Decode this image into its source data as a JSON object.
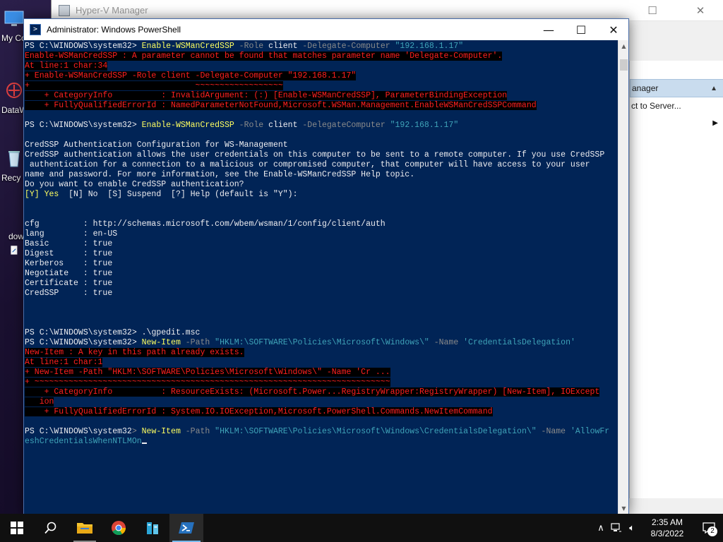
{
  "desktop": {
    "icons": [
      {
        "label": "My Co",
        "icon": "computer-icon"
      },
      {
        "label": "DataW",
        "icon": "app-icon"
      },
      {
        "label": "Recy",
        "icon": "recycle-bin-icon"
      },
      {
        "label": "dow",
        "icon": "file-icon"
      }
    ]
  },
  "hyperv": {
    "title": "Hyper-V Manager",
    "actions_header": "anager",
    "actions": [
      {
        "label": "ct to Server...",
        "has_arrow": false
      },
      {
        "label": "",
        "has_arrow": true
      }
    ]
  },
  "powershell": {
    "title": "Administrator: Windows PowerShell",
    "lines": [
      [
        {
          "t": "PS C:\\WINDOWS\\system32> ",
          "c": "default"
        },
        {
          "t": "Enable-WSManCredSSP",
          "c": "cmd"
        },
        {
          "t": " -Role ",
          "c": "param"
        },
        {
          "t": "client",
          "c": "default"
        },
        {
          "t": " -Delegate-Computer ",
          "c": "param"
        },
        {
          "t": "\"192.168.1.17\"",
          "c": "string"
        }
      ],
      [
        {
          "t": "Enable-WSManCredSSP : A parameter cannot be found that matches parameter name 'Delegate-Computer'.",
          "c": "err"
        }
      ],
      [
        {
          "t": "At line:1 char:34",
          "c": "err"
        }
      ],
      [
        {
          "t": "+ Enable-WSManCredSSP -Role client -Delegate-Computer \"192.168.1.17\"",
          "c": "err"
        }
      ],
      [
        {
          "t": "+                                  ~~~~~~~~~~~~~~~~~~",
          "c": "err"
        }
      ],
      [
        {
          "t": "    + CategoryInfo          : InvalidArgument: (:) [Enable-WSManCredSSP], ParameterBindingException",
          "c": "err"
        }
      ],
      [
        {
          "t": "    + FullyQualifiedErrorId : NamedParameterNotFound,Microsoft.WSMan.Management.EnableWSManCredSSPCommand",
          "c": "err"
        }
      ],
      [
        {
          "t": "",
          "c": "default"
        }
      ],
      [
        {
          "t": "PS C:\\WINDOWS\\system32> ",
          "c": "default"
        },
        {
          "t": "Enable-WSManCredSSP",
          "c": "cmd"
        },
        {
          "t": " -Role ",
          "c": "param"
        },
        {
          "t": "client",
          "c": "default"
        },
        {
          "t": " -DelegateComputer ",
          "c": "param"
        },
        {
          "t": "\"192.168.1.17\"",
          "c": "string"
        }
      ],
      [
        {
          "t": "",
          "c": "default"
        }
      ],
      [
        {
          "t": "CredSSP Authentication Configuration for WS-Management",
          "c": "default"
        }
      ],
      [
        {
          "t": "CredSSP authentication allows the user credentials on this computer to be sent to a remote computer. If you use CredSSP",
          "c": "default"
        }
      ],
      [
        {
          "t": " authentication for a connection to a malicious or compromised computer, that computer will have access to your user",
          "c": "default"
        }
      ],
      [
        {
          "t": "name and password. For more information, see the Enable-WSManCredSSP Help topic.",
          "c": "default"
        }
      ],
      [
        {
          "t": "Do you want to enable CredSSP authentication?",
          "c": "default"
        }
      ],
      [
        {
          "t": "[Y] Yes",
          "c": "prompty"
        },
        {
          "t": "  [N] No  [S] Suspend  [?] Help (default is \"Y\"):",
          "c": "default"
        }
      ],
      [
        {
          "t": "",
          "c": "default"
        }
      ],
      [
        {
          "t": "",
          "c": "default"
        }
      ],
      [
        {
          "t": "cfg         : http://schemas.microsoft.com/wbem/wsman/1/config/client/auth",
          "c": "default"
        }
      ],
      [
        {
          "t": "lang        : en-US",
          "c": "default"
        }
      ],
      [
        {
          "t": "Basic       : true",
          "c": "default"
        }
      ],
      [
        {
          "t": "Digest      : true",
          "c": "default"
        }
      ],
      [
        {
          "t": "Kerberos    : true",
          "c": "default"
        }
      ],
      [
        {
          "t": "Negotiate   : true",
          "c": "default"
        }
      ],
      [
        {
          "t": "Certificate : true",
          "c": "default"
        }
      ],
      [
        {
          "t": "CredSSP     : true",
          "c": "default"
        }
      ],
      [
        {
          "t": "",
          "c": "default"
        }
      ],
      [
        {
          "t": "",
          "c": "default"
        }
      ],
      [
        {
          "t": "",
          "c": "default"
        }
      ],
      [
        {
          "t": "PS C:\\WINDOWS\\system32> ",
          "c": "default"
        },
        {
          "t": ".\\gpedit.msc",
          "c": "default"
        }
      ],
      [
        {
          "t": "PS C:\\WINDOWS\\system32> ",
          "c": "default"
        },
        {
          "t": "New-Item",
          "c": "cmd"
        },
        {
          "t": " -Path ",
          "c": "param"
        },
        {
          "t": "\"HKLM:\\SOFTWARE\\Policies\\Microsoft\\Windows\\\"",
          "c": "string"
        },
        {
          "t": " -Name ",
          "c": "param"
        },
        {
          "t": "'CredentialsDelegation'",
          "c": "string"
        }
      ],
      [
        {
          "t": "New-Item : A key in this path already exists.",
          "c": "err"
        }
      ],
      [
        {
          "t": "At line:1 char:1",
          "c": "err"
        }
      ],
      [
        {
          "t": "+ New-Item -Path \"HKLM:\\SOFTWARE\\Policies\\Microsoft\\Windows\\\" -Name 'Cr ...",
          "c": "err"
        }
      ],
      [
        {
          "t": "+ ~~~~~~~~~~~~~~~~~~~~~~~~~~~~~~~~~~~~~~~~~~~~~~~~~~~~~~~~~~~~~~~~~~~~~~~~~",
          "c": "err"
        }
      ],
      [
        {
          "t": "    + CategoryInfo          : ResourceExists: (Microsoft.Power...RegistryWrapper:RegistryWrapper) [New-Item], IOExcept",
          "c": "err"
        }
      ],
      [
        {
          "t": "   ion",
          "c": "err"
        }
      ],
      [
        {
          "t": "    + FullyQualifiedErrorId : System.IO.IOException,Microsoft.PowerShell.Commands.NewItemCommand",
          "c": "err"
        }
      ],
      [
        {
          "t": "",
          "c": "default"
        }
      ],
      [
        {
          "t": "PS C:\\WINDOWS\\system32",
          "c": "default"
        },
        {
          "t": "> ",
          "c": "gray"
        },
        {
          "t": "New-Item",
          "c": "cmd"
        },
        {
          "t": " -Path ",
          "c": "param"
        },
        {
          "t": "\"HKLM:\\SOFTWARE\\Policies\\Microsoft\\Windows\\CredentialsDelegation\\\"",
          "c": "string"
        },
        {
          "t": " -Name ",
          "c": "param"
        },
        {
          "t": "'AllowFr",
          "c": "string"
        }
      ],
      [
        {
          "t": "eshCredentialsWhenNTLMOn",
          "c": "string"
        }
      ]
    ]
  },
  "taskbar": {
    "clock_time": "2:35 AM",
    "clock_date": "8/3/2022",
    "notification_count": "2",
    "apps": [
      {
        "name": "start-button-icon"
      },
      {
        "name": "search-icon"
      },
      {
        "name": "file-explorer-icon"
      },
      {
        "name": "chrome-icon"
      },
      {
        "name": "server-manager-icon"
      },
      {
        "name": "powershell-icon"
      }
    ]
  }
}
